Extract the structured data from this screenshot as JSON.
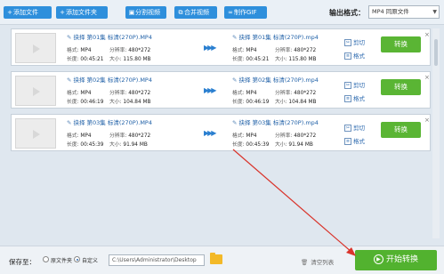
{
  "toolbar": {
    "add_file": "添加文件",
    "add_folder": "添加文件夹",
    "split": "分割视频",
    "merge": "合并视频",
    "make_gif": "制作GIF",
    "output_format_label": "输出格式：",
    "output_format_value": "MP4 同原文件"
  },
  "labels": {
    "format": "格式:",
    "duration": "长度:",
    "resolution": "分辨率:",
    "size": "大小:",
    "cut": "剪切",
    "fmt": "格式",
    "convert": "转换"
  },
  "files": [
    {
      "source_name": "抉择 第01集 标清(270P).MP4",
      "target_name": "抉择 第01集 标清(270P).mp4",
      "format": "MP4",
      "duration": "00:45:21",
      "resolution": "480*272",
      "size": "115.80 MB"
    },
    {
      "source_name": "抉择 第02集 标清(270P).MP4",
      "target_name": "抉择 第02集 标清(270P).mp4",
      "format": "MP4",
      "duration": "00:46:19",
      "resolution": "480*272",
      "size": "104.84 MB"
    },
    {
      "source_name": "抉择 第03集 标清(270P).MP4",
      "target_name": "抉择 第03集 标清(270P).mp4",
      "format": "MP4",
      "duration": "00:45:39",
      "resolution": "480*272",
      "size": "91.94 MB"
    }
  ],
  "bottom": {
    "save_to": "保存至：",
    "option_original": "原文件夹",
    "option_custom": "自定义",
    "path": "C:\\Users\\Administrator\\Desktop",
    "clear_list": "清空列表",
    "start": "开始转换"
  },
  "colors": {
    "toolbar_button": "#2e8fdc",
    "convert_button": "#5ab534",
    "start_button": "#52b22f",
    "annotation_arrow": "#d9342b"
  }
}
